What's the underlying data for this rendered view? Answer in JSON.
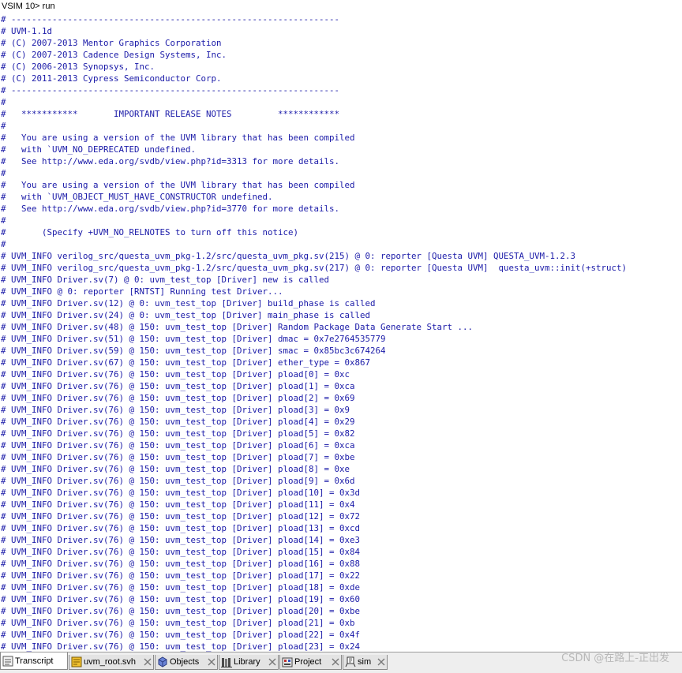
{
  "transcript": {
    "prompt": "VSIM 10> run",
    "lines": [
      {
        "text": "# ----------------------------------------------------------------",
        "color": "blue"
      },
      {
        "text": "# UVM-1.1d",
        "color": "blue"
      },
      {
        "text": "# (C) 2007-2013 Mentor Graphics Corporation",
        "color": "blue"
      },
      {
        "text": "# (C) 2007-2013 Cadence Design Systems, Inc.",
        "color": "blue"
      },
      {
        "text": "# (C) 2006-2013 Synopsys, Inc.",
        "color": "blue"
      },
      {
        "text": "# (C) 2011-2013 Cypress Semiconductor Corp.",
        "color": "blue"
      },
      {
        "text": "# ----------------------------------------------------------------",
        "color": "blue"
      },
      {
        "text": "#",
        "color": "blue"
      },
      {
        "text": "#   ***********       IMPORTANT RELEASE NOTES         ************",
        "color": "blue"
      },
      {
        "text": "#",
        "color": "blue"
      },
      {
        "text": "#   You are using a version of the UVM library that has been compiled",
        "color": "blue"
      },
      {
        "text": "#   with `UVM_NO_DEPRECATED undefined.",
        "color": "blue"
      },
      {
        "text": "#   See http://www.eda.org/svdb/view.php?id=3313 for more details.",
        "color": "blue"
      },
      {
        "text": "#",
        "color": "blue"
      },
      {
        "text": "#   You are using a version of the UVM library that has been compiled",
        "color": "blue"
      },
      {
        "text": "#   with `UVM_OBJECT_MUST_HAVE_CONSTRUCTOR undefined.",
        "color": "blue"
      },
      {
        "text": "#   See http://www.eda.org/svdb/view.php?id=3770 for more details.",
        "color": "blue"
      },
      {
        "text": "#",
        "color": "blue"
      },
      {
        "text": "#       (Specify +UVM_NO_RELNOTES to turn off this notice)",
        "color": "blue"
      },
      {
        "text": "#",
        "color": "blue"
      },
      {
        "text": "# UVM_INFO verilog_src/questa_uvm_pkg-1.2/src/questa_uvm_pkg.sv(215) @ 0: reporter [Questa UVM] QUESTA_UVM-1.2.3",
        "color": "blue"
      },
      {
        "text": "# UVM_INFO verilog_src/questa_uvm_pkg-1.2/src/questa_uvm_pkg.sv(217) @ 0: reporter [Questa UVM]  questa_uvm::init(+struct)",
        "color": "blue"
      },
      {
        "text": "# UVM_INFO Driver.sv(7) @ 0: uvm_test_top [Driver] new is called",
        "color": "blue"
      },
      {
        "text": "# UVM_INFO @ 0: reporter [RNTST] Running test Driver...",
        "color": "blue"
      },
      {
        "text": "# UVM_INFO Driver.sv(12) @ 0: uvm_test_top [Driver] build_phase is called",
        "color": "blue"
      },
      {
        "text": "# UVM_INFO Driver.sv(24) @ 0: uvm_test_top [Driver] main_phase is called",
        "color": "blue"
      },
      {
        "text": "# UVM_INFO Driver.sv(48) @ 150: uvm_test_top [Driver] Random Package Data Generate Start ...",
        "color": "blue"
      },
      {
        "text": "# UVM_INFO Driver.sv(51) @ 150: uvm_test_top [Driver] dmac = 0x7e2764535779",
        "color": "blue"
      },
      {
        "text": "# UVM_INFO Driver.sv(59) @ 150: uvm_test_top [Driver] smac = 0x85bc3c674264",
        "color": "blue"
      },
      {
        "text": "# UVM_INFO Driver.sv(67) @ 150: uvm_test_top [Driver] ether_type = 0x867",
        "color": "blue"
      },
      {
        "text": "# UVM_INFO Driver.sv(76) @ 150: uvm_test_top [Driver] pload[0] = 0xc",
        "color": "blue"
      },
      {
        "text": "# UVM_INFO Driver.sv(76) @ 150: uvm_test_top [Driver] pload[1] = 0xca",
        "color": "blue"
      },
      {
        "text": "# UVM_INFO Driver.sv(76) @ 150: uvm_test_top [Driver] pload[2] = 0x69",
        "color": "blue"
      },
      {
        "text": "# UVM_INFO Driver.sv(76) @ 150: uvm_test_top [Driver] pload[3] = 0x9",
        "color": "blue"
      },
      {
        "text": "# UVM_INFO Driver.sv(76) @ 150: uvm_test_top [Driver] pload[4] = 0x29",
        "color": "blue"
      },
      {
        "text": "# UVM_INFO Driver.sv(76) @ 150: uvm_test_top [Driver] pload[5] = 0x82",
        "color": "blue"
      },
      {
        "text": "# UVM_INFO Driver.sv(76) @ 150: uvm_test_top [Driver] pload[6] = 0xca",
        "color": "blue"
      },
      {
        "text": "# UVM_INFO Driver.sv(76) @ 150: uvm_test_top [Driver] pload[7] = 0xbe",
        "color": "blue"
      },
      {
        "text": "# UVM_INFO Driver.sv(76) @ 150: uvm_test_top [Driver] pload[8] = 0xe",
        "color": "blue"
      },
      {
        "text": "# UVM_INFO Driver.sv(76) @ 150: uvm_test_top [Driver] pload[9] = 0x6d",
        "color": "blue"
      },
      {
        "text": "# UVM_INFO Driver.sv(76) @ 150: uvm_test_top [Driver] pload[10] = 0x3d",
        "color": "blue"
      },
      {
        "text": "# UVM_INFO Driver.sv(76) @ 150: uvm_test_top [Driver] pload[11] = 0x4",
        "color": "blue"
      },
      {
        "text": "# UVM_INFO Driver.sv(76) @ 150: uvm_test_top [Driver] pload[12] = 0x72",
        "color": "blue"
      },
      {
        "text": "# UVM_INFO Driver.sv(76) @ 150: uvm_test_top [Driver] pload[13] = 0xcd",
        "color": "blue"
      },
      {
        "text": "# UVM_INFO Driver.sv(76) @ 150: uvm_test_top [Driver] pload[14] = 0xe3",
        "color": "blue"
      },
      {
        "text": "# UVM_INFO Driver.sv(76) @ 150: uvm_test_top [Driver] pload[15] = 0x84",
        "color": "blue"
      },
      {
        "text": "# UVM_INFO Driver.sv(76) @ 150: uvm_test_top [Driver] pload[16] = 0x88",
        "color": "blue"
      },
      {
        "text": "# UVM_INFO Driver.sv(76) @ 150: uvm_test_top [Driver] pload[17] = 0x22",
        "color": "blue"
      },
      {
        "text": "# UVM_INFO Driver.sv(76) @ 150: uvm_test_top [Driver] pload[18] = 0xde",
        "color": "blue"
      },
      {
        "text": "# UVM_INFO Driver.sv(76) @ 150: uvm_test_top [Driver] pload[19] = 0x60",
        "color": "blue"
      },
      {
        "text": "# UVM_INFO Driver.sv(76) @ 150: uvm_test_top [Driver] pload[20] = 0xbe",
        "color": "blue"
      },
      {
        "text": "# UVM_INFO Driver.sv(76) @ 150: uvm_test_top [Driver] pload[21] = 0xb",
        "color": "blue"
      },
      {
        "text": "# UVM_INFO Driver.sv(76) @ 150: uvm_test_top [Driver] pload[22] = 0x4f",
        "color": "blue"
      },
      {
        "text": "# UVM_INFO Driver.sv(76) @ 150: uvm_test_top [Driver] pload[23] = 0x24",
        "color": "blue"
      }
    ]
  },
  "tabs": [
    {
      "label": "Transcript",
      "icon": "transcript-icon",
      "active": true
    },
    {
      "label": "uvm_root.svh",
      "icon": "source-file-icon",
      "active": false
    },
    {
      "label": "Objects",
      "icon": "objects-icon",
      "active": false
    },
    {
      "label": "Library",
      "icon": "library-icon",
      "active": false
    },
    {
      "label": "Project",
      "icon": "project-icon",
      "active": false
    },
    {
      "label": "sim",
      "icon": "sim-icon",
      "active": false
    }
  ],
  "watermark": "CSDN @在路上-正出发",
  "colors": {
    "log_text": "#1a1aa8",
    "prompt_text": "#000000",
    "tab_bar_bg": "#eeeeee",
    "watermark": "#b8b8b8"
  }
}
